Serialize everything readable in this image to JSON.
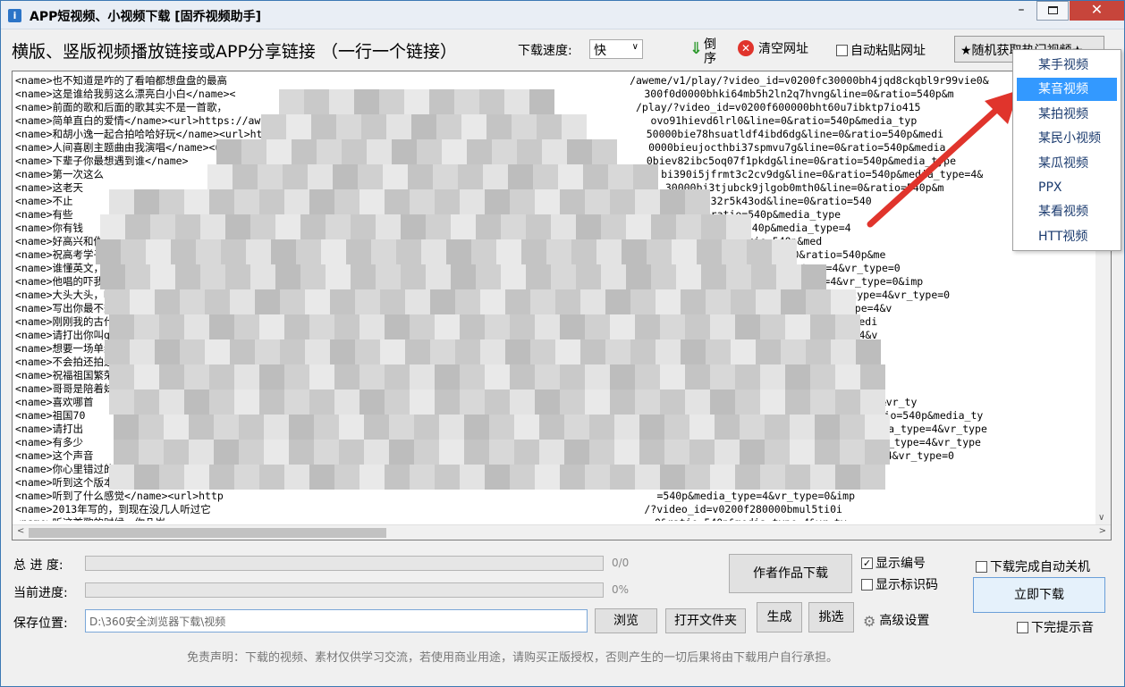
{
  "window": {
    "title": "APP短视频、小视频下载 [固乔视频助手]",
    "icon_text": "i",
    "minimize_glyph": "–",
    "close_glyph": "✕"
  },
  "toolbar": {
    "heading": "横版、竖版视频播放链接或APP分享链接  （一行一个链接）",
    "speed_label": "下载速度:",
    "speed_value": "快",
    "reverse_label": "倒序",
    "clear_label": "清空网址",
    "auto_paste_label": "自动粘贴网址",
    "random_label": "★随机获取热门视频★"
  },
  "links": [
    "<name>也不知道是咋的了看咱都想盘盘的最高                                                                 /aweme/v1/play/?video_id=v0200fc30000bh4jqd8ckqbl9r99vie0&",
    "<name>这是谁给我剪这么漂亮白小白</name><                                                                  300f0d0000bhki64mb5h2ln2q7hvng&line=0&ratio=540p&m",
    "<name>前面的歌和后面的歌其实不是一首歌，                                                                  /play/?video_id=v0200f600000bht60u7ibktp7io415",
    "<name>简单直白的爱情</name><url>https://aweme                                                            ovo91hievd6lrl0&line=0&ratio=540p&media_typ",
    "<name>和胡小逸一起合拍哈哈好玩</name><url>https://awem                                                    50000bie78hsuatldf4ibd6dg&line=0&ratio=540p&medi",
    "<name>人间喜剧主题曲由我演唱</name><url>h                                                                 0000bieujocthbi37spmvu7g&line=0&ratio=540p&media",
    "<name>下辈子你最想遇到谁</name>                                                                          0biev82ibc5oq07f1pkdg&line=0&ratio=540p&media_type",
    "<name>第一次这么                                                                                          bi390i5jfrmt3c2cv9dg&line=0&ratio=540p&media_type=4&",
    "<name>这老天                                                                                              30000bj3tjubck9jlgob0mth0&line=0&ratio=540p&m",
    "<name>不止                                                                                                9hrskif32r5k43od&line=0&ratio=540",
    "<name>有些                                                                                                line=0&ratio=540p&media_type",
    "<name>你有钱                                                                                              line=0&ratio=540p&media_type=4",
    "<name>好高兴和你                                                                                          jpsg&line=0&ratio=540p&med",
    "<name>祝高考学子金榜题名，只要现                                                                          t3salvcdde9qr972ug&line=0&ratio=540p&me",
    "<name>谁懂英文，翻译一下</name                                                                            line=0&ratio=540p&media_type=4&vr_type=0",
    "<name>他唱的吓我一跳</name><ur                                                                           line=0&ratio=540p&media_type=4&vr_type=0&imp",
    "<name>大头大头，嗨起来吧</name>                                                                           2t00tf0&line=0&ratio=540p&media_type=4&vr_type=0",
    "<name>写出你最不想离开的人的名字                                                                          f3ckthg&line=0&ratio=540p&media_type=4&v",
    "<name>刚刚我的古代身份原来我这么高                                                                        s7fbmpp89ah7jug&line=0&ratio=540p&medi",
    "<name>请打出你叫giao什么名，哈哈                                                                          het0&line=0&ratio=540p&media_type=4&v",
    "<name>想要一场单纯放肆唱歌的演唱会                                                                        46g6h8rqmuit2jp0&line=0&ratio=540p&me",
    "<name>不会拍还拍这么好，上哪说理去                                                                        cl81jg5t7jg&line=0&ratio=540p&media_ty",
    "<name>祝福祖国繁荣昌盛青春吉林我们一起                                                                    000bm4uqmamac2jfjd1f2hg&line=0&ratio=5",
    "<name>哥哥是陪着妹妹玩的，结果哥哥比妹妹玩得更开心                                                        200f9f0000bs08167pq3n8s8570epg&line=0&r",
    "<name>喜欢哪首                                                                                           umpig&line=0&ratio=540p&media_type=4&vr_ty",
    "<name>祖国70                                                                                              0000bm9fa33c86dvfet7sjd0&line=0&ratio=540p&media_ty",
    "<name>请打出                                                                                              8cv2d1r9ihr50&line=0&ratio=540p&media_type=4&vr_type",
    "<name>有多少                                                                                              c0n5fsh359ag&line=0&ratio=540p&media_type=4&vr_type",
    "<name>这个声音                                                                                            dumj70&line=0&ratio=540p&media_type=4&vr_type=0",
    "<name>你心里错过的那个人是谁</name><                                                                      &line=0&ratio=540p&media_type=4&vr_ty",
    "<name>听到这个版本想到了什么</name><                                                                      =0&ratio=540p&media_type=4&vr_type=0",
    "<name>听到了什么感觉</name><url>http                                                                      =540p&media_type=4&vr_type=0&imp",
    "<name>2013年写的，到现在没几人听过它                                                                      /?video_id=v0200f280000bmul5ti0i",
    "<name>听这首歌的时候，你几岁                                                                              =0&ratio=540p&media_type=4&vr_ty"
  ],
  "source_menu": {
    "items": [
      "某手视频",
      "某音视频",
      "某拍视频",
      "某民小视频",
      "某瓜视频",
      "PPX",
      "某看视频",
      "HTT视频"
    ],
    "selected_index": 1
  },
  "progress": {
    "total_label": "总 进 度:",
    "total_text": "0/0",
    "total_fraction": 0,
    "current_label": "当前进度:",
    "current_text": "0%",
    "current_fraction": 0
  },
  "save": {
    "label": "保存位置:",
    "path": "D:\\360安全浏览器下载\\视频",
    "browse_label": "浏览",
    "open_folder_label": "打开文件夹"
  },
  "actions": {
    "author_download_label": "作者作品下载",
    "generate_label": "生成",
    "pick_label": "挑选",
    "show_number_label": "显示编号",
    "show_number_checked": true,
    "show_code_label": "显示标识码",
    "show_code_checked": false,
    "advanced_label": "高级设置",
    "shutdown_label": "下载完成自动关机",
    "shutdown_checked": false,
    "download_now_label": "立即下载",
    "notify_label": "下完提示音",
    "notify_checked": false
  },
  "disclaimer": "免责声明：下载的视频、素材仅供学习交流，若使用商业用途，请购买正版授权，否则产生的一切后果将由下载用户自行承担。",
  "colors": {
    "accent": "#3399ff",
    "close": "#c7453b",
    "arrow": "#e0342c"
  }
}
